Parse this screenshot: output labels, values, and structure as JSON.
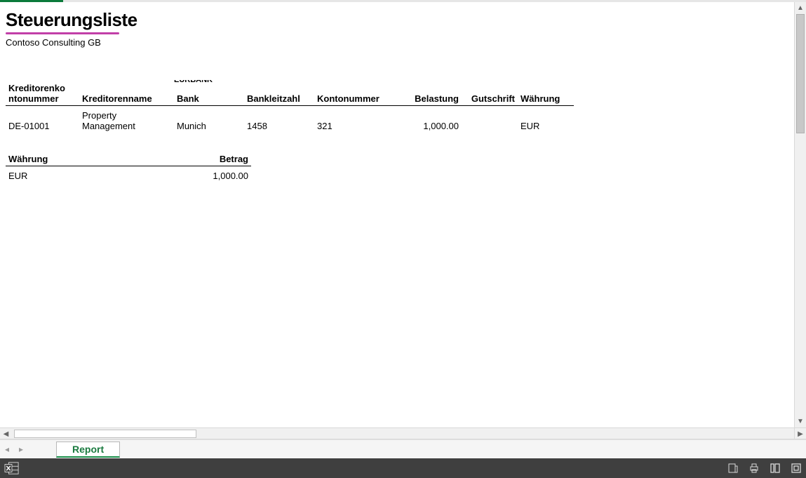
{
  "report": {
    "title": "Steuerungsliste",
    "company": "Contoso Consulting GB"
  },
  "main_table": {
    "headers": {
      "kreditor_nr": "Kreditorenko\nntonummer",
      "kreditor_name": "Kreditorenname",
      "bank": "Bank",
      "blz": "Bankleitzahl",
      "konto": "Kontonummer",
      "belastung": "Belastung",
      "gutschrift": "Gutschrift",
      "waehrung": "Währung"
    },
    "bank_artifact": "EURBANK",
    "rows": [
      {
        "kreditor_nr": "DE-01001",
        "kreditor_name": "Property Management",
        "bank": "Munich",
        "blz": "1458",
        "konto": "321",
        "belastung": "1,000.00",
        "gutschrift": "",
        "waehrung": "EUR"
      }
    ]
  },
  "summary_table": {
    "headers": {
      "waehrung": "Währung",
      "betrag": "Betrag"
    },
    "rows": [
      {
        "waehrung": "EUR",
        "betrag": "1,000.00"
      }
    ]
  },
  "sheet_tab": "Report"
}
